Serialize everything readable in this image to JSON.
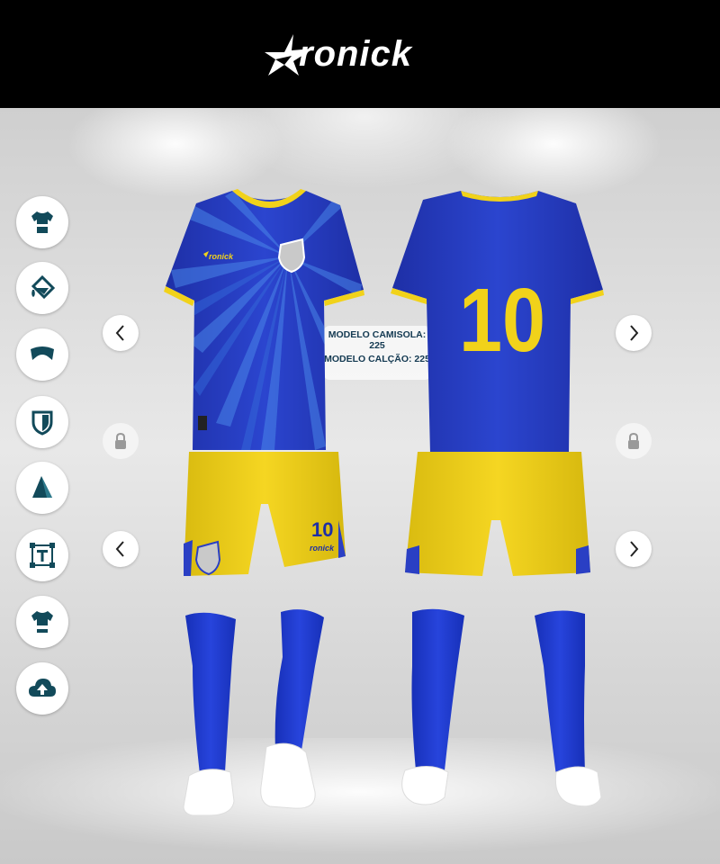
{
  "brand": {
    "name": "ronick",
    "logo_colors": {
      "text": "#ffffff",
      "background": "#000000"
    }
  },
  "toolbar": {
    "tools": [
      {
        "name": "shirt-model-icon"
      },
      {
        "name": "paint-bucket-icon"
      },
      {
        "name": "collar-icon"
      },
      {
        "name": "crest-shield-icon"
      },
      {
        "name": "pattern-icon"
      },
      {
        "name": "text-icon"
      },
      {
        "name": "sponsor-shirt-icon"
      },
      {
        "name": "cloud-upload-icon"
      }
    ]
  },
  "model_info": {
    "shirt": "MODELO CAMISOLA: 225",
    "shorts": "MODELO CALÇÃO: 225"
  },
  "kit": {
    "shirt_number": "10",
    "shorts_number": "10",
    "chest_brand": "ronick",
    "shorts_brand": "ronick",
    "colors": {
      "primary": "#2a3fc4",
      "secondary": "#f1d21a",
      "accent": "#3d7de0",
      "socks": "#1f3bd0",
      "boots": "#ffffff"
    }
  },
  "controls": {
    "prev_label": "‹",
    "next_label": "›"
  }
}
